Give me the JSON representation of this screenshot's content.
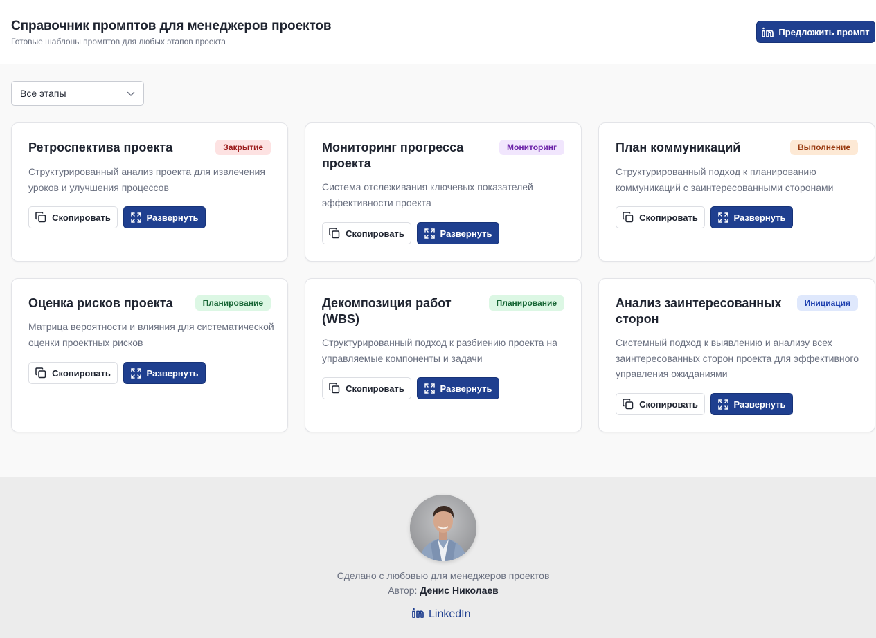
{
  "header": {
    "title": "Справочник промптов для менеджеров проектов",
    "subtitle": "Готовые шаблоны промптов для любых этапов проекта",
    "suggest_label": "Предложить промпт"
  },
  "filter": {
    "selected": "Все этапы"
  },
  "colors": {
    "primary": "#1f3f8f",
    "badge_closing": "#fde2e2",
    "badge_monitoring": "#f1e6fd",
    "badge_execution": "#fde9d5",
    "badge_planning": "#dcf7e4",
    "badge_initiation": "#dfe8fc"
  },
  "cards": [
    {
      "title": "Ретроспектива проекта",
      "badge": "Закрытие",
      "description": "Структурированный анализ проекта для извлечения уроков и улучшения процессов",
      "copy_label": "Скопировать",
      "expand_label": "Развернуть"
    },
    {
      "title": "Мониторинг прогресса проекта",
      "badge": "Мониторинг",
      "description": "Система отслеживания ключевых показателей эффективности проекта",
      "copy_label": "Скопировать",
      "expand_label": "Развернуть"
    },
    {
      "title": "План коммуникаций",
      "badge": "Выполнение",
      "description": "Структурированный подход к планированию коммуникаций с заинтересованными сторонами",
      "copy_label": "Скопировать",
      "expand_label": "Развернуть"
    },
    {
      "title": "Оценка рисков проекта",
      "badge": "Планирование",
      "description": "Матрица вероятности и влияния для систематической оценки проектных рисков",
      "copy_label": "Скопировать",
      "expand_label": "Развернуть"
    },
    {
      "title": "Декомпозиция работ (WBS)",
      "badge": "Планирование",
      "description": "Структурированный подход к разбиению проекта на управляемые компоненты и задачи",
      "copy_label": "Скопировать",
      "expand_label": "Развернуть"
    },
    {
      "title": "Анализ заинтересованных сторон",
      "badge": "Инициация",
      "description": "Системный подход к выявлению и анализу всех заинтересованных сторон проекта для эффективного управления ожиданиями",
      "copy_label": "Скопировать",
      "expand_label": "Развернуть"
    }
  ],
  "footer": {
    "love_text": "Сделано с любовью для менеджеров проектов",
    "author_prefix": "Автор:",
    "author_name": "Денис Николаев",
    "link_label": "LinkedIn"
  },
  "icons": {
    "header_button": "linkedin-icon",
    "copy": "copy-icon",
    "expand": "expand-icon",
    "select": "chevron-down-icon",
    "footer_link": "linkedin-icon"
  }
}
